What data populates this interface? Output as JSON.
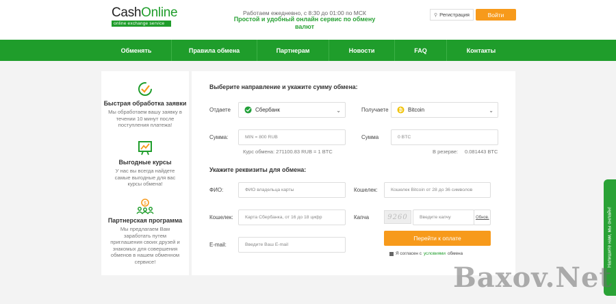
{
  "header": {
    "logo_main": "Cash",
    "logo_accent": "Online",
    "logo_sub": "online exchange service",
    "hours": "Работаем ежедневно, с 8:30 до 01:00 по МСК",
    "tagline": "Простой и удобный онлайн сервис по обмену валют",
    "register_label": "Регистрация",
    "login_label": "Войти"
  },
  "nav": {
    "items": [
      "Обменять",
      "Правила обмена",
      "Партнерам",
      "Новости",
      "FAQ",
      "Контакты"
    ]
  },
  "sidebar": {
    "features": [
      {
        "icon": "check-timer-icon",
        "title": "Быстрая обработка заявки",
        "text": "Мы обработаем вашу заявку в течении 10 минут после поступления платежа!"
      },
      {
        "icon": "chart-board-icon",
        "title": "Выгодные курсы",
        "text": "У нас вы всегда найдете самые выгодные для вас курсы обмена!"
      },
      {
        "icon": "partners-icon",
        "title": "Партнерская программа",
        "text": "Мы предлагаем Вам заработать путем приглашения своих друзей и знакомых для совершения обменов в нашем обменном сервисе!"
      }
    ]
  },
  "exchange": {
    "heading": "Выберите направление и укажите сумму обмена:",
    "give_label": "Отдаете",
    "give_value": "Сбербанк",
    "get_label": "Получаете",
    "get_value": "Bitcoin",
    "sum_label_left": "Сумма:",
    "sum_placeholder_left": "MIN = 800 RUB",
    "sum_label_right": "Сумма",
    "sum_placeholder_right": "0 BTC",
    "rate": "Курс обмена: 271100.83 RUB = 1 BTC",
    "reserve_label": "В резерве:",
    "reserve_value": "0.081443 BTC"
  },
  "details": {
    "heading": "Укажите реквизиты для обмена:",
    "fio_label": "ФИО:",
    "fio_placeholder": "ФИО владельца карты",
    "wallet_right_label": "Кошелек:",
    "wallet_right_placeholder": "Кошелек Bitcoin от 28 до 36 символов",
    "wallet_left_label": "Кошелек:",
    "wallet_left_placeholder": "Карта Сбербанка, от 16 до 18 цифр",
    "captcha_label": "Капча",
    "captcha_image_text": "9260",
    "captcha_placeholder": "Введите капчу",
    "captcha_refresh": "Обнов.",
    "email_label": "E-mail:",
    "email_placeholder": "Введите Ваш E-mail",
    "pay_label": "Перейти к оплате",
    "agree_prefix": "Я согласен с",
    "agree_link": "условиями",
    "agree_suffix": "обмена"
  },
  "chat": {
    "label": "Напишите нам, мы онлайн!"
  },
  "watermark": "Baxov.Net",
  "colors": {
    "brand_green": "#1f9d2b",
    "accent_orange": "#f79a1b"
  }
}
